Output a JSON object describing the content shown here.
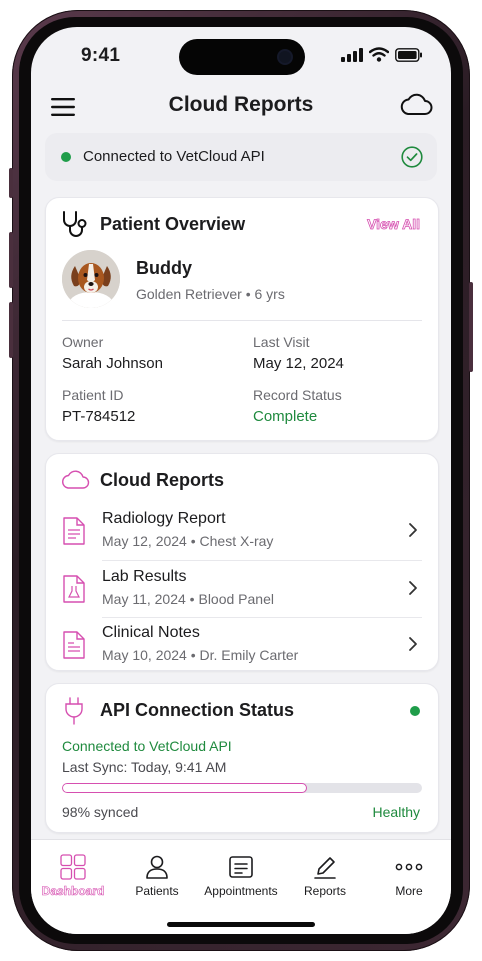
{
  "status_bar": {
    "time": "9:41"
  },
  "header": {
    "title": "Cloud Reports"
  },
  "banner": {
    "text": "Connected to VetCloud API",
    "status_color": "#1f9d4a"
  },
  "patient_overview": {
    "title": "Patient Overview",
    "view_all": "View All",
    "pet": {
      "name": "Buddy",
      "breed_age": "Golden Retriever • 6 yrs"
    },
    "fields": {
      "owner_label": "Owner",
      "owner_value": "Sarah Johnson",
      "last_visit_label": "Last Visit",
      "last_visit_value": "May 12, 2024",
      "patient_id_label": "Patient ID",
      "patient_id_value": "PT-784512",
      "record_status_label": "Record Status",
      "record_status_value": "Complete"
    }
  },
  "cloud_reports": {
    "title": "Cloud Reports",
    "items": [
      {
        "title": "Radiology Report",
        "subtitle": "May 12, 2024 • Chest X-ray"
      },
      {
        "title": "Lab Results",
        "subtitle": "May 11, 2024 • Blood Panel"
      },
      {
        "title": "Clinical Notes",
        "subtitle": "May 10, 2024 • Dr. Emily Carter"
      }
    ]
  },
  "api_status": {
    "title": "API Connection Status",
    "connected": "Connected to VetCloud API",
    "last_sync": "Last Sync: Today, 9:41 AM",
    "progress_percent": 68,
    "synced_label": "98% synced",
    "health": "Healthy"
  },
  "tabs": [
    {
      "label": "Dashboard",
      "icon": "grid-icon",
      "active": true
    },
    {
      "label": "Patients",
      "icon": "person-icon"
    },
    {
      "label": "Appointments",
      "icon": "calendar-list-icon"
    },
    {
      "label": "Reports",
      "icon": "edit-icon"
    },
    {
      "label": "More",
      "icon": "more-icon"
    }
  ],
  "colors": {
    "accent": "#d64fb0",
    "success": "#1f8a3e"
  }
}
